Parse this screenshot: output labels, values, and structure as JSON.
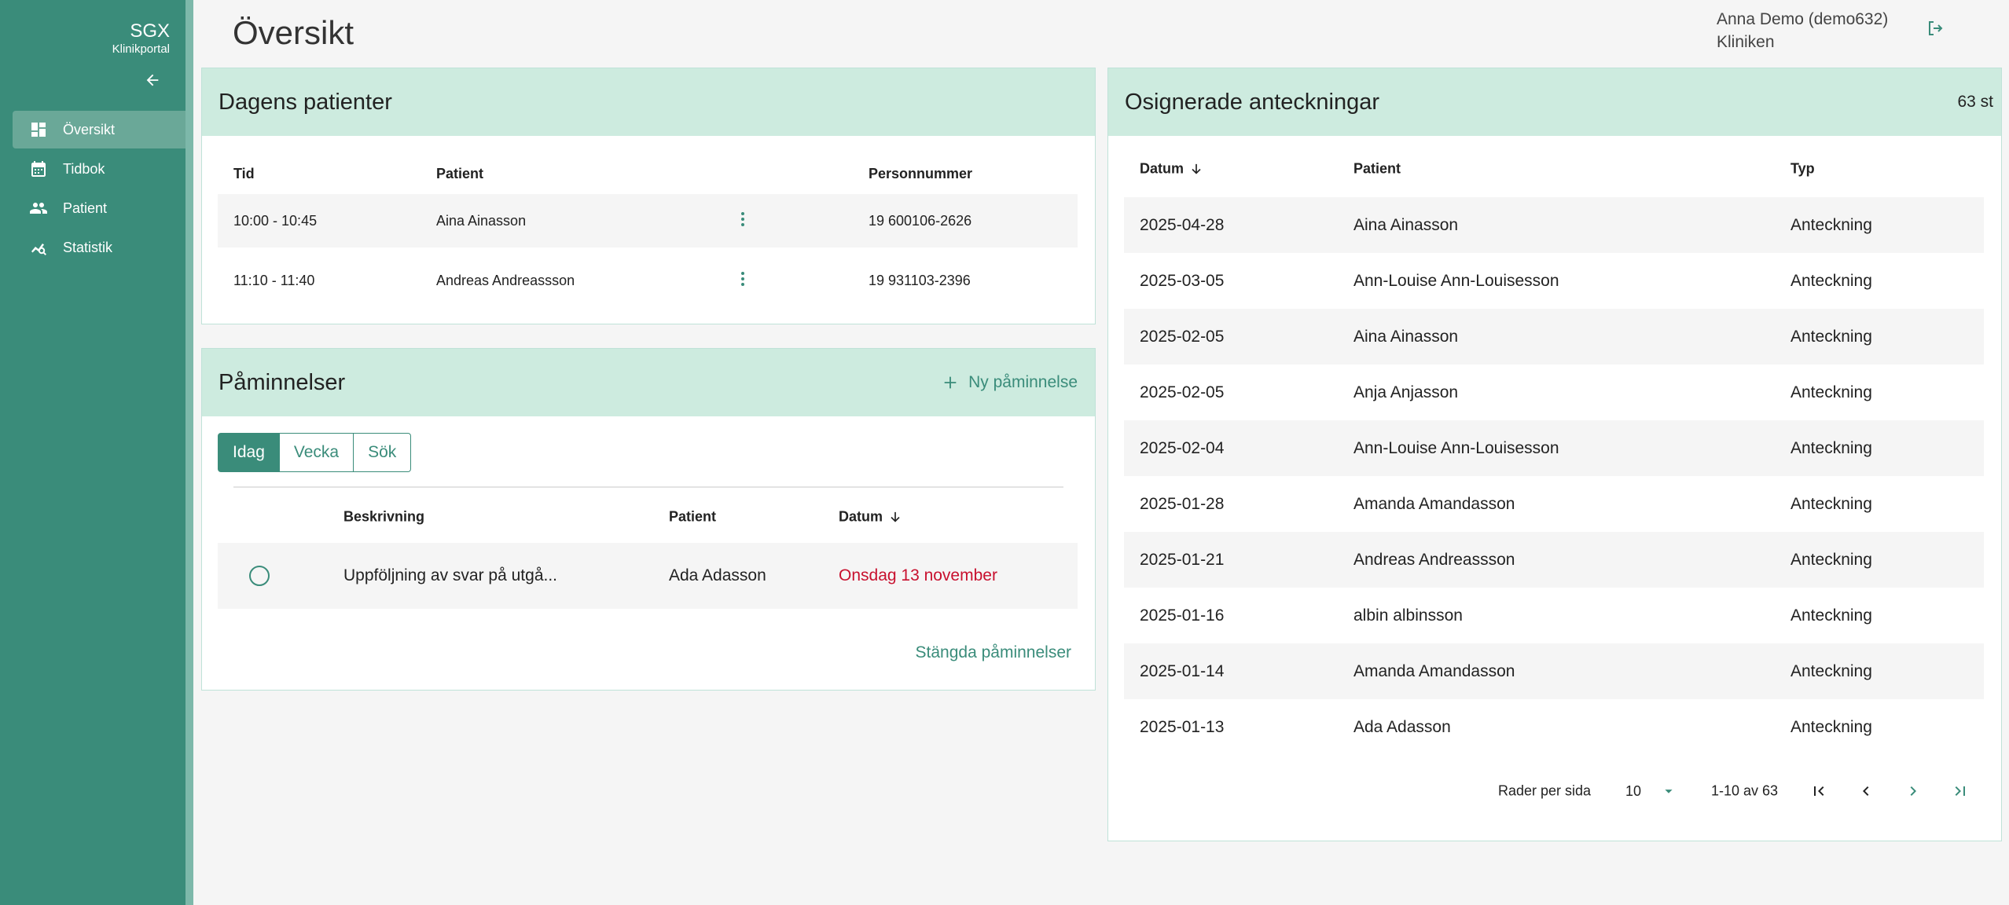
{
  "brand": {
    "name": "SGX",
    "subtitle": "Klinikportal"
  },
  "nav": [
    {
      "label": "Översikt",
      "icon": "dashboard-icon",
      "active": true
    },
    {
      "label": "Tidbok",
      "icon": "calendar-icon",
      "active": false
    },
    {
      "label": "Patient",
      "icon": "people-icon",
      "active": false
    },
    {
      "label": "Statistik",
      "icon": "statistics-icon",
      "active": false
    }
  ],
  "header": {
    "title": "Översikt",
    "user_name": "Anna Demo (demo632)",
    "user_org": "Kliniken"
  },
  "todays_patients": {
    "title": "Dagens patienter",
    "columns": [
      "Tid",
      "Patient",
      "Personnummer"
    ],
    "rows": [
      {
        "tid": "10:00 - 10:45",
        "patient": "Aina Ainasson",
        "pnr": "19 600106-2626"
      },
      {
        "tid": "11:10 - 11:40",
        "patient": "Andreas Andreassson",
        "pnr": "19 931103-2396"
      }
    ]
  },
  "reminders": {
    "title": "Påminnelser",
    "new_label": "Ny påminnelse",
    "tabs": [
      "Idag",
      "Vecka",
      "Sök"
    ],
    "active_tab": "Idag",
    "columns": [
      "Beskrivning",
      "Patient",
      "Datum"
    ],
    "rows": [
      {
        "description": "Uppföljning av svar på utgå...",
        "patient": "Ada Adasson",
        "date": "Onsdag 13 november"
      }
    ],
    "closed_link": "Stängda påminnelser",
    "colors": {
      "overdue": "#c8102e"
    }
  },
  "unsigned_notes": {
    "title": "Osignerade anteckningar",
    "count": "63 st",
    "columns": [
      "Datum",
      "Patient",
      "Typ"
    ],
    "rows": [
      {
        "date": "2025-04-28",
        "patient": "Aina Ainasson",
        "type": "Anteckning"
      },
      {
        "date": "2025-03-05",
        "patient": "Ann-Louise Ann-Louisesson",
        "type": "Anteckning"
      },
      {
        "date": "2025-02-05",
        "patient": "Aina Ainasson",
        "type": "Anteckning"
      },
      {
        "date": "2025-02-05",
        "patient": "Anja Anjasson",
        "type": "Anteckning"
      },
      {
        "date": "2025-02-04",
        "patient": "Ann-Louise Ann-Louisesson",
        "type": "Anteckning"
      },
      {
        "date": "2025-01-28",
        "patient": "Amanda Amandasson",
        "type": "Anteckning"
      },
      {
        "date": "2025-01-21",
        "patient": "Andreas Andreassson",
        "type": "Anteckning"
      },
      {
        "date": "2025-01-16",
        "patient": "albin albinsson",
        "type": "Anteckning"
      },
      {
        "date": "2025-01-14",
        "patient": "Amanda Amandasson",
        "type": "Anteckning"
      },
      {
        "date": "2025-01-13",
        "patient": "Ada Adasson",
        "type": "Anteckning"
      }
    ],
    "pager": {
      "rows_per_page_label": "Rader per sida",
      "rows_per_page": "10",
      "range": "1-10 av 63"
    }
  },
  "colors": {
    "primary": "#3a8c7a",
    "card_header": "#cdebdf",
    "sidebar": "#3a8c7a"
  }
}
